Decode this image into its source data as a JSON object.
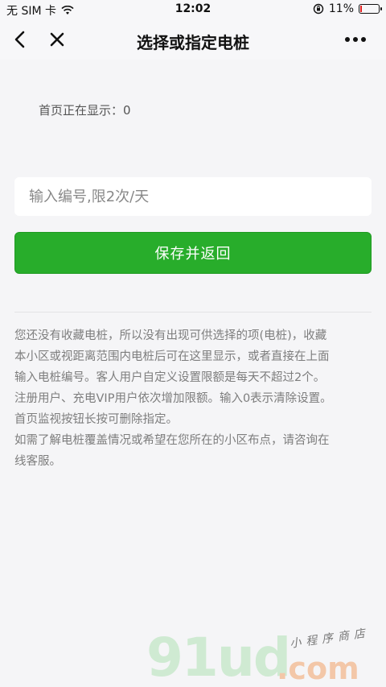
{
  "status_bar": {
    "carrier": "无 SIM 卡",
    "time": "12:02",
    "battery_percent": "11%",
    "battery_level": 0.11
  },
  "nav": {
    "title": "选择或指定电桩"
  },
  "display_text": "首页正在显示：0",
  "input": {
    "placeholder": "输入编号,限2次/天",
    "value": ""
  },
  "save_button_label": "保存并返回",
  "help_lines": [
    "您还没有收藏电桩，所以没有出现可供选择的项(电桩)，收藏",
    "本小区或视距离范围内电桩后可在这里显示，或者直接在上面",
    "输入电桩编号。客人用户自定义设置限额是每天不超过2个。",
    "注册用户、充电VIP用户依次增加限额。输入0表示清除设置。",
    "首页监视按钮长按可删除指定。",
    "如需了解电桩覆盖情况或希望在您所在的小区布点，请咨询在",
    "线客服。"
  ],
  "watermark": {
    "big": "91ud",
    "com": ".com",
    "cn": "小程序商店"
  },
  "colors": {
    "accent_green": "#28ad2b",
    "battery_low": "#e02020"
  }
}
